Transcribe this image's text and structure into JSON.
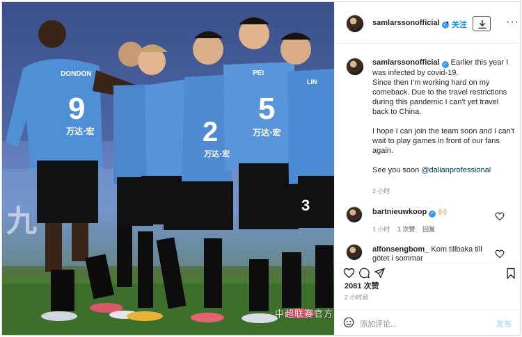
{
  "photo": {
    "jersey_names": [
      "DONDON",
      "PEI",
      "LIN"
    ],
    "jersey_numbers": [
      "9",
      "2",
      "5",
      "3"
    ],
    "sponsor": "万达·宏",
    "watermark": "中超联赛官方"
  },
  "post": {
    "username": "samlarssonofficial",
    "follow_label": "关注",
    "caption": "Earlier this year I was infected by covid-19.\nSince then I'm working hard on my comeback. Due to the travel restrictions during this pandemic I can't yet travel back to China.\n\nI hope I can join the team soon and I can't wait to play games in front of our fans again.\n\nSee you soon ",
    "caption_mention": "@dalianprofessional",
    "caption_time": "2 小时",
    "likes": "2081 次赞",
    "post_time": "2 小时前",
    "comment_placeholder": "添加评论...",
    "post_button": "发布"
  },
  "comments": [
    {
      "username": "bartnieuwkoop",
      "verified": true,
      "text": "🙌🏻",
      "time": "1 小时",
      "likes": "1 次赞",
      "reply": "回复"
    },
    {
      "username": "alfonsengbom_",
      "verified": false,
      "text": "Kom tillbaka till götet i sommar",
      "time": "",
      "likes": "",
      "reply": ""
    }
  ],
  "colors": {
    "accent": "#0095f6",
    "verified": "#3897f0",
    "muted": "#8e8e8e"
  },
  "icons": [
    "download-icon",
    "more-icon",
    "heart-icon",
    "comment-icon",
    "share-icon",
    "bookmark-icon",
    "emoji-icon"
  ]
}
